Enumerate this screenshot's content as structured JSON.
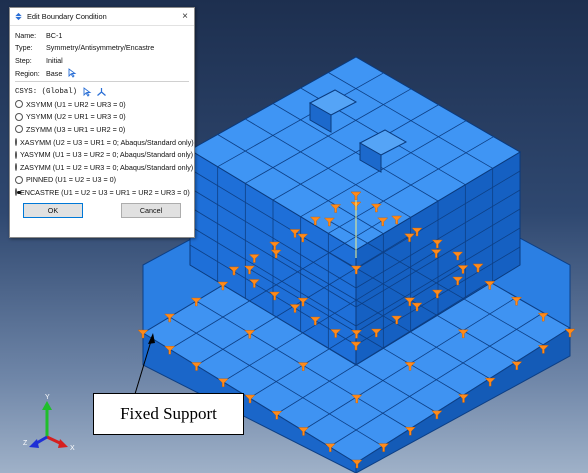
{
  "dialog": {
    "title": "Edit Boundary Condition",
    "close": "×",
    "name_label": "Name:",
    "name_value": "BC-1",
    "type_label": "Type:",
    "type_value": "Symmetry/Antisymmetry/Encastre",
    "step_label": "Step:",
    "step_value": "Initial",
    "region_label": "Region:",
    "region_value": "Base",
    "csys_label": "CSYS: (Global)",
    "options": [
      {
        "label": "XSYMM (U1 = UR2 = UR3 = 0)",
        "selected": false
      },
      {
        "label": "YSYMM (U2 = UR1 = UR3 = 0)",
        "selected": false
      },
      {
        "label": "ZSYMM (U3 = UR1 = UR2 = 0)",
        "selected": false
      },
      {
        "label": "XASYMM (U2 = U3 = UR1 = 0; Abaqus/Standard only)",
        "selected": false
      },
      {
        "label": "YASYMM (U1 = U3 = UR2 = 0; Abaqus/Standard only)",
        "selected": false
      },
      {
        "label": "ZASYMM (U1 = U2 = UR3 = 0; Abaqus/Standard only)",
        "selected": false
      },
      {
        "label": "PINNED (U1 = U2 = U3 = 0)",
        "selected": false
      },
      {
        "label": "ENCASTRE (U1 = U2 = U3 = UR1 = UR2 = UR3 = 0)",
        "selected": true
      }
    ],
    "ok_label": "OK",
    "cancel_label": "Cancel"
  },
  "callout": {
    "text": "Fixed Support"
  },
  "triad": {
    "x": "X",
    "y": "Y",
    "z": "Z"
  },
  "colors": {
    "model": "#1e78e6",
    "support": "#ff8a1a",
    "selection": "#f0f08a"
  }
}
